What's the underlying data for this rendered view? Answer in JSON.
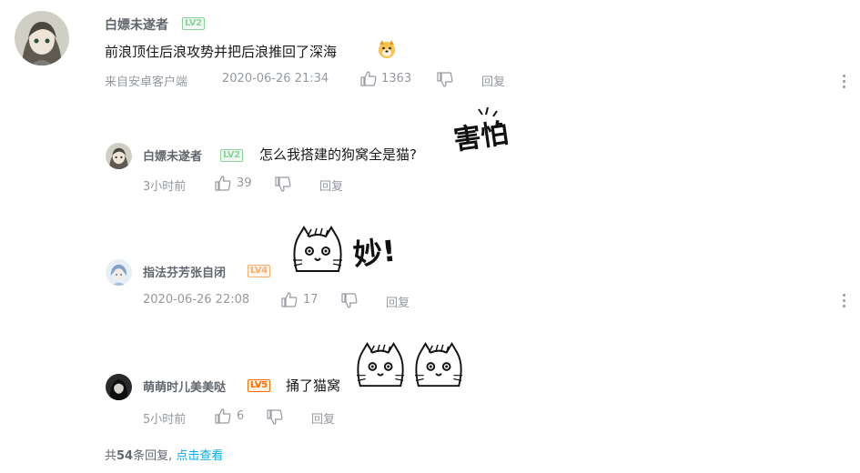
{
  "comment": {
    "user": "白嫖未遂者",
    "level": "LV2",
    "text": "前浪顶住后浪攻势并把后浪推回了深海",
    "source": "来自安卓客户端",
    "time": "2020-06-26 21:34",
    "likes": "1363",
    "reply_label": "回复"
  },
  "replies": [
    {
      "user": "白嫖未遂者",
      "level": "LV2",
      "text": "怎么我搭建的狗窝全是猫?",
      "sticker_label": "害怕",
      "time": "3小时前",
      "likes": "39",
      "reply_label": "回复"
    },
    {
      "user": "指法芬芳张自闭",
      "level": "LV4",
      "text": "",
      "sticker_label": "妙!",
      "time": "2020-06-26 22:08",
      "likes": "17",
      "reply_label": "回复"
    },
    {
      "user": "萌萌时儿美美哒",
      "level": "LV5",
      "text": "捅了猫窝",
      "time": "5小时前",
      "likes": "6",
      "reply_label": "回复"
    }
  ],
  "footer": {
    "prefix": "共",
    "count": "54",
    "suffix": "条回复,",
    "link": "点击查看"
  },
  "icons": {
    "like": "thumb-up-icon",
    "dislike": "thumb-down-icon",
    "more": "more-vertical-icon"
  }
}
